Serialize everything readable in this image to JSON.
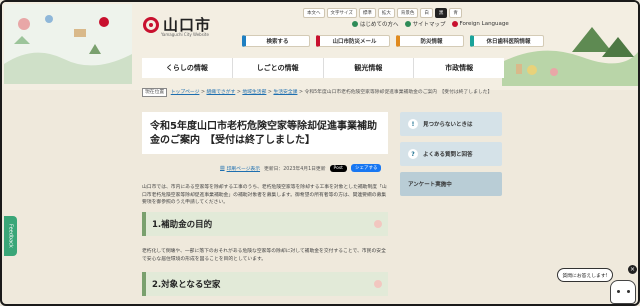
{
  "header": {
    "logo_text": "山口市",
    "logo_sub": "Yamaguchi City Website",
    "util": [
      "本文へ",
      "文字サイズ",
      "標準",
      "拡大",
      "背景色",
      "白",
      "黒",
      "青"
    ],
    "links": [
      "はじめての方へ",
      "サイトマップ",
      "Foreign Language"
    ],
    "tabs": [
      "検索する",
      "山口市防災メール",
      "防災情報",
      "休日歯科医院情報"
    ],
    "mainnav": [
      "くらしの情報",
      "しごとの情報",
      "観光情報",
      "市政情報"
    ]
  },
  "breadcrumb": {
    "here": "現在位置",
    "items": [
      "トップページ",
      "組織でさがす",
      "地域生活部",
      "生活安全課"
    ],
    "current": "令和5年度山口市老朽危険空家等除却促進事業補助金のご案内　【受付は終了しました】"
  },
  "article": {
    "title": "令和5年度山口市老朽危険空家等除却促進事業補助金のご案内　【受付は終了しました】",
    "print": "印刷ページ表示",
    "updated": "更新日：2023年4月1日更新",
    "post": "Post",
    "share": "シェアする",
    "intro": "山口市では、市内にある空家等を除却する工事のうち、老朽危険空家等を除却する工事を対象とした補助制度「山口市老朽危険空家等除却促進事業補助金」の補助対象者を募集します。御希望の所有者等の方は、関連要綱の募集要項を御参照のうえ申請してください。",
    "h2_1": "1.補助金の目的",
    "para1": "老朽化して倒壊や、一部に落下のおそれがある危険な空家等の除却に対して補助金を交付することで、市民の安全で安心な居住環境の形成を図ることを目的としています。",
    "h2_2": "2.対象となる空家"
  },
  "sidebar": {
    "items": [
      "見つからないときは",
      "よくある質問と回答",
      "アンケート実施中"
    ]
  },
  "floating": {
    "feedback": "Feedback",
    "chat": "質問にお答えします!",
    "close": "×"
  }
}
